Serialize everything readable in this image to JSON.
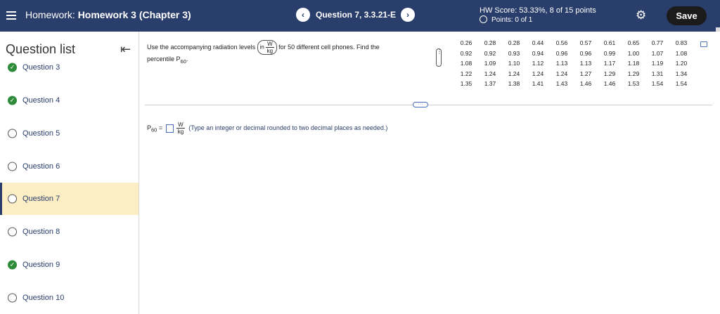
{
  "header": {
    "prefix": "Homework:",
    "title": "Homework 3 (Chapter 3)",
    "prev_label": "‹",
    "question_label": "Question 7, 3.3.21-E",
    "next_label": "›",
    "score": "HW Score: 53.33%, 8 of 15 points",
    "points": "Points: 0 of 1",
    "save_label": "Save"
  },
  "sidebar": {
    "title": "Question list",
    "items": [
      {
        "label": "Question 3",
        "status": "complete"
      },
      {
        "label": "Question 4",
        "status": "complete"
      },
      {
        "label": "Question 5",
        "status": "incomplete"
      },
      {
        "label": "Question 6",
        "status": "incomplete"
      },
      {
        "label": "Question 7",
        "status": "current"
      },
      {
        "label": "Question 8",
        "status": "incomplete"
      },
      {
        "label": "Question 9",
        "status": "complete"
      },
      {
        "label": "Question 10",
        "status": "incomplete"
      }
    ]
  },
  "question": {
    "text_before": "Use the accompanying radiation levels",
    "paren_in": "in",
    "unit_num": "W",
    "unit_den": "kg",
    "text_after": "for 50 different cell phones. Find the",
    "line2_prefix": "percentile P",
    "line2_sub": "60",
    "line2_suffix": "."
  },
  "data_table": {
    "rows": [
      [
        "0.26",
        "0.28",
        "0.28",
        "0.44",
        "0.56",
        "0.57",
        "0.61",
        "0.65",
        "0.77",
        "0.83"
      ],
      [
        "0.92",
        "0.92",
        "0.93",
        "0.94",
        "0.96",
        "0.96",
        "0.99",
        "1.00",
        "1.07",
        "1.08"
      ],
      [
        "1.08",
        "1.09",
        "1.10",
        "1.12",
        "1.13",
        "1.13",
        "1.17",
        "1.18",
        "1.19",
        "1.20"
      ],
      [
        "1.22",
        "1.24",
        "1.24",
        "1.24",
        "1.24",
        "1.27",
        "1.29",
        "1.29",
        "1.31",
        "1.34"
      ],
      [
        "1.35",
        "1.37",
        "1.38",
        "1.41",
        "1.43",
        "1.46",
        "1.46",
        "1.53",
        "1.54",
        "1.54"
      ]
    ]
  },
  "answer": {
    "label_prefix": "P",
    "label_sub": "60",
    "equals": "=",
    "unit_num": "W",
    "unit_den": "kg",
    "hint": "(Type an integer or decimal rounded to two decimal places as needed.)"
  },
  "colors": {
    "topbar": "#2a3e6b",
    "active_item": "#fbeec5",
    "check_green": "#2e8b3a",
    "save_button": "#1b1b1b"
  },
  "icons": {
    "menu": "hamburger-icon",
    "settings": "gear-icon",
    "collapse": "collapse-left-icon",
    "complete": "check-circle-icon",
    "incomplete": "empty-circle-icon",
    "copy": "copy-icon"
  }
}
